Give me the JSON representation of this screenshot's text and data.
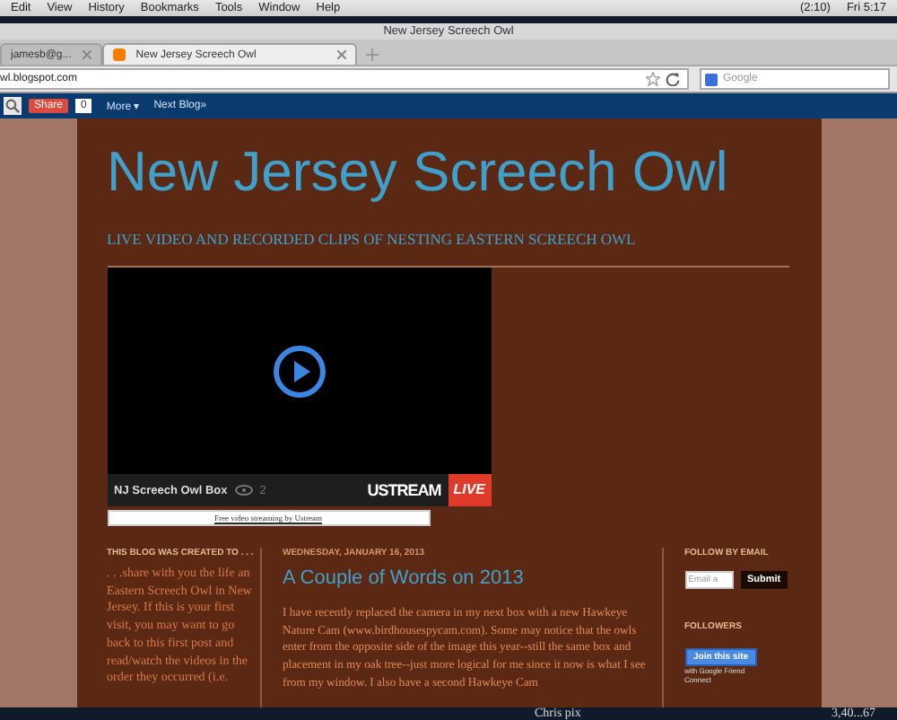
{
  "menu_bar": {
    "items": [
      "Edit",
      "View",
      "History",
      "Bookmarks",
      "Tools",
      "Window",
      "Help"
    ],
    "battery": "(2:10)",
    "clock": "Fri 5:17"
  },
  "window": {
    "title": "New Jersey Screech Owl"
  },
  "tabs": [
    {
      "label": "jamesb@g...",
      "selected": false
    },
    {
      "label": "New Jersey Screech Owl",
      "selected": true
    }
  ],
  "address_bar": {
    "url": "wl.blogspot.com",
    "search_placeholder": "Google"
  },
  "navbar": {
    "share": "Share",
    "share_count": "0",
    "more": "More ▾",
    "next": "Next Blog»"
  },
  "blog": {
    "title": "New Jersey Screech Owl",
    "description": "LIVE VIDEO AND RECORDED CLIPS OF NESTING EASTERN SCREECH OWL",
    "video": {
      "channel": "NJ Screech Owl Box",
      "views": "2",
      "brand": "USTREAM",
      "live": "LIVE",
      "credit": "Free video streaming by Ustream"
    }
  },
  "sidebar_left": {
    "heading": "THIS BLOG WAS CREATED TO . . .",
    "text": ". . .share with you the life an Eastern Screech Owl in New Jersey. If this is your first visit, you may want to go back to this first post and read/watch the videos in the order they occurred (i.e."
  },
  "post": {
    "date": "WEDNESDAY, JANUARY 16, 2013",
    "title": "A Couple of Words on 2013",
    "body": "I have recently replaced the camera in my next box with a new Hawkeye Nature Cam (www.birdhousespycam.com).  Some may notice that the owls enter from the opposite side of the image this year--still the same box and placement in my oak tree--just more logical for me since it now is what I see from my window.  I also have a second Hawkeye Cam"
  },
  "sidebar_right": {
    "email_heading": "FOLLOW BY EMAIL",
    "email_placeholder": "Email a",
    "submit": "Submit",
    "followers_heading": "FOLLOWERS",
    "join": "Join this site",
    "join_note": "with Google Friend Connect"
  },
  "dock": {
    "items": [
      "Chris pix",
      "3,40...67"
    ]
  }
}
